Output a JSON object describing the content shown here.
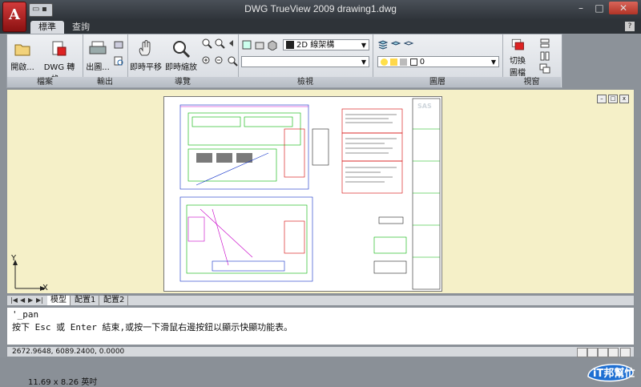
{
  "window": {
    "title": "DWG TrueView 2009 drawing1.dwg"
  },
  "tabs": [
    {
      "label": "標準"
    },
    {
      "label": "查詢"
    }
  ],
  "help_label": "?",
  "ribbon": {
    "file_panel": {
      "label": "檔案",
      "open_label": "開啟...",
      "convert_label": "DWG 轉換..."
    },
    "output_panel": {
      "label": "輸出",
      "plot_label": "出圖..."
    },
    "nav_panel": {
      "label": "導覽",
      "pan_label": "即時平移",
      "zoom_label": "即時縮放"
    },
    "view_panel": {
      "label": "檢視",
      "visual_style": "2D 線架構"
    },
    "layer_panel": {
      "label": "圖層",
      "layer_value": "0"
    },
    "window_panel": {
      "label": "視窗",
      "switch_label1": "切換",
      "switch_label2": "圖檔"
    }
  },
  "layout_tabs": [
    {
      "label": "模型"
    },
    {
      "label": "配置1"
    },
    {
      "label": "配置2"
    }
  ],
  "ucs": {
    "x_label": "X",
    "y_label": "Y"
  },
  "command": {
    "line1": "'_pan",
    "line2": "按下 Esc 或 Enter 結束,或按一下滑鼠右邊按鈕以顯示快顯功能表。"
  },
  "status": {
    "coords": "2672.9648, 6089.2400, 0.0000"
  },
  "page": {
    "size": "11.69 x 8.26 英吋"
  },
  "watermark": {
    "text": "iT邦幫忙"
  },
  "colors": {
    "canvas": "#f5f0c8",
    "title_bar": "#2f343a",
    "app_button": "#b21f1f"
  }
}
